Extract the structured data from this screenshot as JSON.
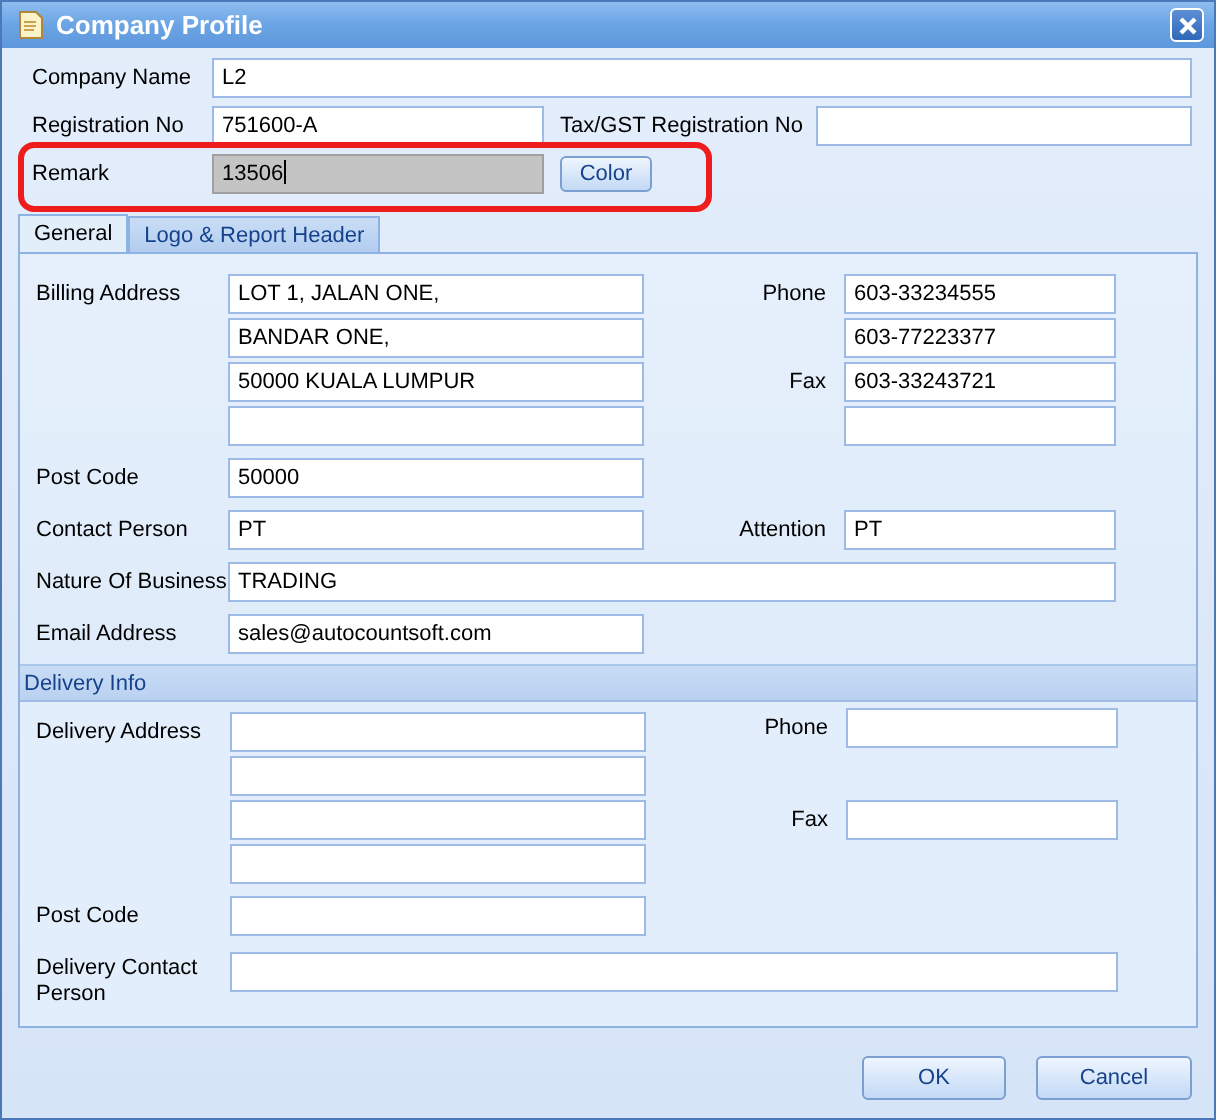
{
  "window": {
    "title": "Company Profile"
  },
  "company_name": {
    "label": "Company Name",
    "value": "L2"
  },
  "registration_no": {
    "label": "Registration No",
    "value": "751600-A"
  },
  "tax_gst_registration_no": {
    "label": "Tax/GST Registration No"
  },
  "remark": {
    "label": "Remark",
    "value": "13506",
    "focused": true
  },
  "color_button": {
    "label": "Color"
  },
  "tabs": [
    {
      "label": "General",
      "selected": true
    },
    {
      "label": "Logo & Report Header",
      "selected": false
    }
  ],
  "general": {
    "billing_address": {
      "label": "Billing Address",
      "lines": [
        "LOT 1, JALAN ONE,",
        "BANDAR ONE,",
        "50000 KUALA LUMPUR"
      ]
    },
    "phone": {
      "label": "Phone",
      "values": [
        "603-33234555",
        "603-77223377"
      ]
    },
    "fax": {
      "label": "Fax",
      "values": [
        "603-33243721"
      ]
    },
    "post_code": {
      "label": "Post Code",
      "value": "50000"
    },
    "contact_person": {
      "label": "Contact Person",
      "value": "PT"
    },
    "attention": {
      "label": "Attention",
      "value": "PT"
    },
    "nature_of_business": {
      "label": "Nature Of Business",
      "value": "TRADING"
    },
    "email_address": {
      "label": "Email Address",
      "value": "sales@autocountsoft.com"
    }
  },
  "delivery_info": {
    "title": "Delivery Info",
    "delivery_address": {
      "label": "Delivery Address"
    },
    "phone": {
      "label": "Phone"
    },
    "fax": {
      "label": "Fax"
    },
    "post_code": {
      "label": "Post Code"
    },
    "contact_person": {
      "label": "Delivery Contact Person"
    }
  },
  "buttons": [
    {
      "label": "OK"
    },
    {
      "label": "Cancel"
    }
  ]
}
